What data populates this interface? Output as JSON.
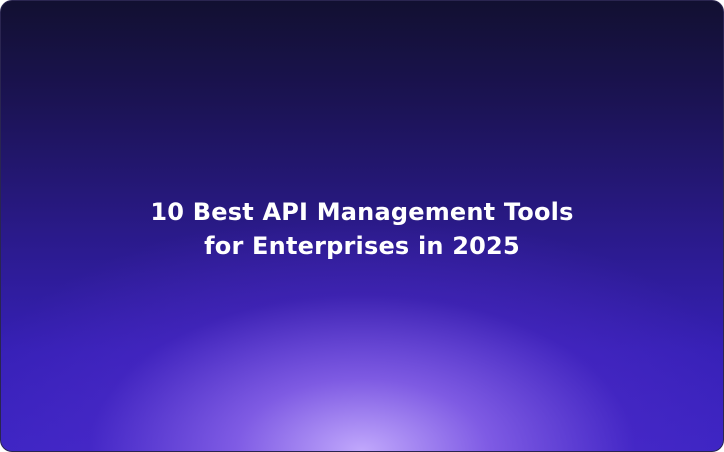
{
  "hero": {
    "title_line_1": "10 Best API Management Tools",
    "title_line_2": "for Enterprises in 2025"
  },
  "colors": {
    "background_top": "#121031",
    "background_mid": "#2a1a8a",
    "background_bottom": "#3b24c3",
    "glow": "#c8afff",
    "text": "#ffffff"
  }
}
